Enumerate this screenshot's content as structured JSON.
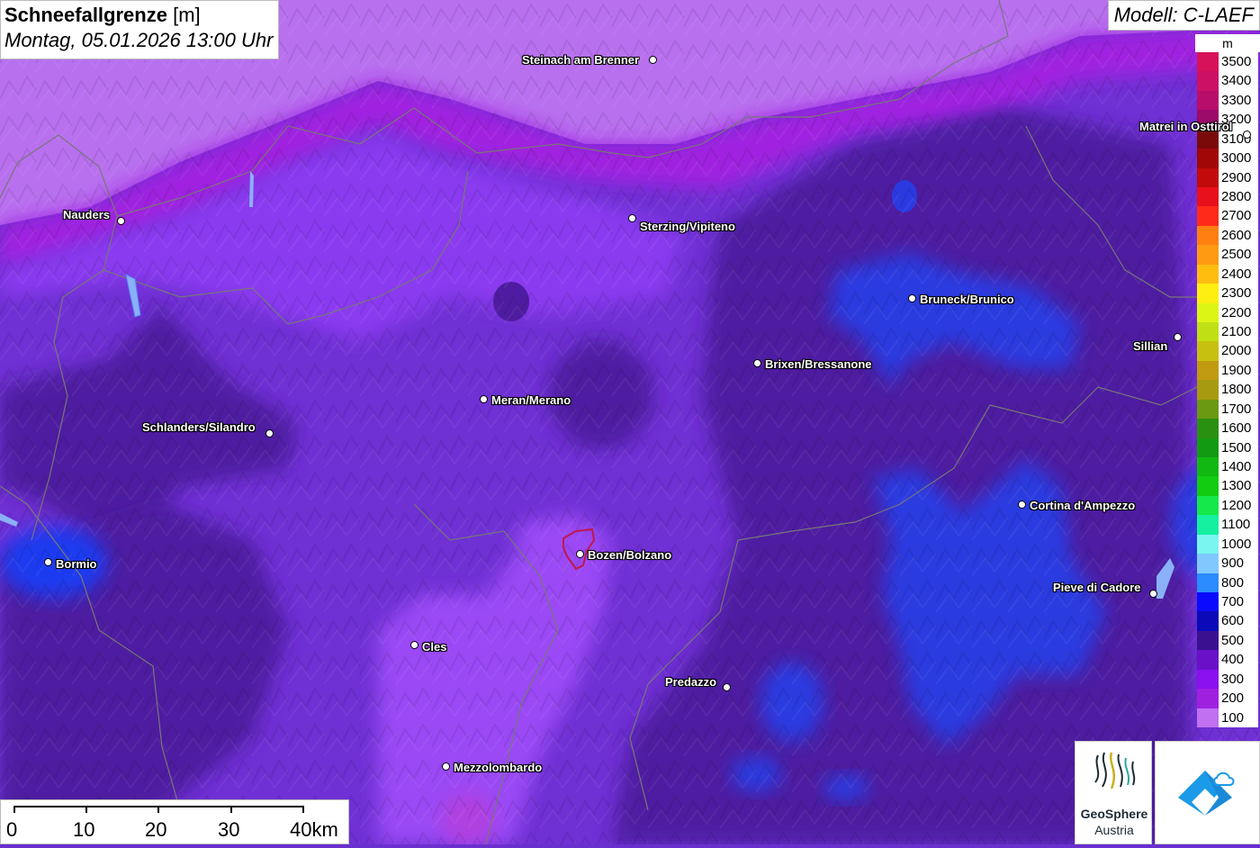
{
  "title": {
    "bold": "Schneefallgrenze",
    "unit": "[m]",
    "datetime": "Montag, 05.01.2026 13:00 Uhr"
  },
  "model": "Modell: C-LAEF",
  "legend": {
    "unit": "m",
    "items": [
      {
        "label": "3500",
        "color": "#d6125a"
      },
      {
        "label": "3400",
        "color": "#cc1066"
      },
      {
        "label": "3300",
        "color": "#b80e6b"
      },
      {
        "label": "3200",
        "color": "#9c0a6a"
      },
      {
        "label": "3100",
        "color": "#7a0a0a"
      },
      {
        "label": "3000",
        "color": "#a00808"
      },
      {
        "label": "2900",
        "color": "#c20a0a"
      },
      {
        "label": "2800",
        "color": "#e8101a"
      },
      {
        "label": "2700",
        "color": "#ff2a1a"
      },
      {
        "label": "2600",
        "color": "#ff7f10"
      },
      {
        "label": "2500",
        "color": "#ff9a12"
      },
      {
        "label": "2400",
        "color": "#ffbd10"
      },
      {
        "label": "2300",
        "color": "#ffee12"
      },
      {
        "label": "2200",
        "color": "#dcf515"
      },
      {
        "label": "2100",
        "color": "#c0e015"
      },
      {
        "label": "2000",
        "color": "#c8c010"
      },
      {
        "label": "1900",
        "color": "#c09a10"
      },
      {
        "label": "1800",
        "color": "#a89a10"
      },
      {
        "label": "1700",
        "color": "#6b9a12"
      },
      {
        "label": "1600",
        "color": "#2a9012"
      },
      {
        "label": "1500",
        "color": "#129a12"
      },
      {
        "label": "1400",
        "color": "#12b812"
      },
      {
        "label": "1300",
        "color": "#12cc12"
      },
      {
        "label": "1200",
        "color": "#15e84a"
      },
      {
        "label": "1100",
        "color": "#15f0a0"
      },
      {
        "label": "1000",
        "color": "#7af5f0"
      },
      {
        "label": "900",
        "color": "#80c8ff"
      },
      {
        "label": "800",
        "color": "#2a8cff"
      },
      {
        "label": "700",
        "color": "#0a0aff"
      },
      {
        "label": "600",
        "color": "#0a0ab8"
      },
      {
        "label": "500",
        "color": "#3a1090"
      },
      {
        "label": "400",
        "color": "#6a10c8"
      },
      {
        "label": "300",
        "color": "#8a10f0"
      },
      {
        "label": "200",
        "color": "#a020e0"
      },
      {
        "label": "100",
        "color": "#c070f0"
      }
    ]
  },
  "cities": [
    {
      "name": "Steinach am Brenner"
    },
    {
      "name": "Nauders"
    },
    {
      "name": "Sterzing/Vipiteno"
    },
    {
      "name": "Matrei in Osttirol"
    },
    {
      "name": "Bruneck/Brunico"
    },
    {
      "name": "Sillian"
    },
    {
      "name": "Brixen/Bressanone"
    },
    {
      "name": "Meran/Merano"
    },
    {
      "name": "Schlanders/Silandro"
    },
    {
      "name": "Cortina d'Ampezzo"
    },
    {
      "name": "Bozen/Bolzano"
    },
    {
      "name": "Bormio"
    },
    {
      "name": "Pieve di Cadore"
    },
    {
      "name": "Cles"
    },
    {
      "name": "Predazzo"
    },
    {
      "name": "Mezzolombardo"
    }
  ],
  "scale": {
    "labels": [
      "0",
      "10",
      "20",
      "30",
      "40km"
    ]
  },
  "logo": {
    "line1": "GeoSphere",
    "line2": "Austria"
  }
}
